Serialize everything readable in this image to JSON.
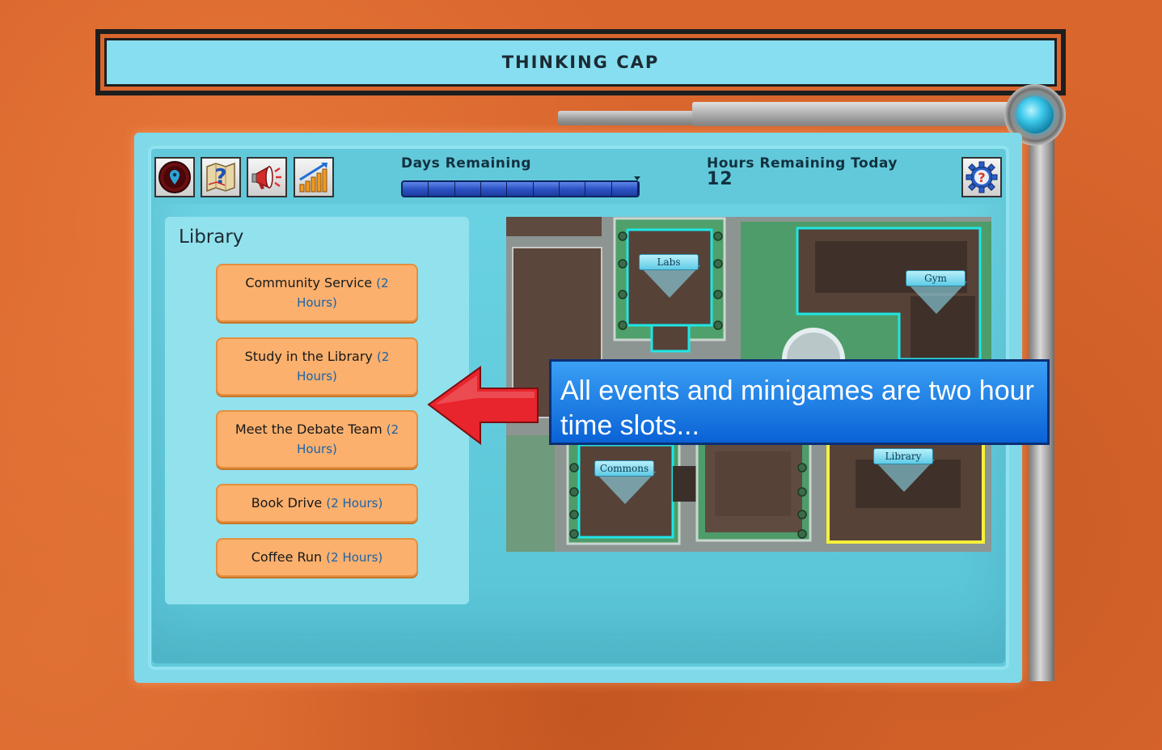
{
  "header": {
    "title": "THINKING CAP"
  },
  "hud": {
    "days_label": "Days Remaining",
    "days_segments": 9,
    "hours_label": "Hours Remaining Today",
    "hours_value": "12"
  },
  "toolbar": {
    "buttons": [
      {
        "icon": "map-pin-icon"
      },
      {
        "icon": "quest-map-icon"
      },
      {
        "icon": "megaphone-icon"
      },
      {
        "icon": "stats-chart-icon"
      }
    ],
    "settings_icon": "help-gear-icon"
  },
  "location": {
    "title": "Library",
    "events": [
      {
        "name": "Community Service",
        "duration": "(2 Hours)"
      },
      {
        "name": "Study in the Library",
        "duration": "(2 Hours)"
      },
      {
        "name": "Meet the Debate Team",
        "duration": "(2 Hours)"
      },
      {
        "name": "Book Drive",
        "duration": "(2 Hours)"
      },
      {
        "name": "Coffee Run",
        "duration": "(2 Hours)"
      }
    ]
  },
  "map": {
    "labels": {
      "labs": "Labs",
      "gym": "Gym",
      "commons": "Commons",
      "library": "Library"
    },
    "selected": "Library",
    "colors": {
      "highlight": "#1ee6e6",
      "selected": "#f5f03a"
    }
  },
  "tutorial": {
    "message": "All events and minigames are two hour time slots...",
    "arrow_color": "#e8242c"
  }
}
